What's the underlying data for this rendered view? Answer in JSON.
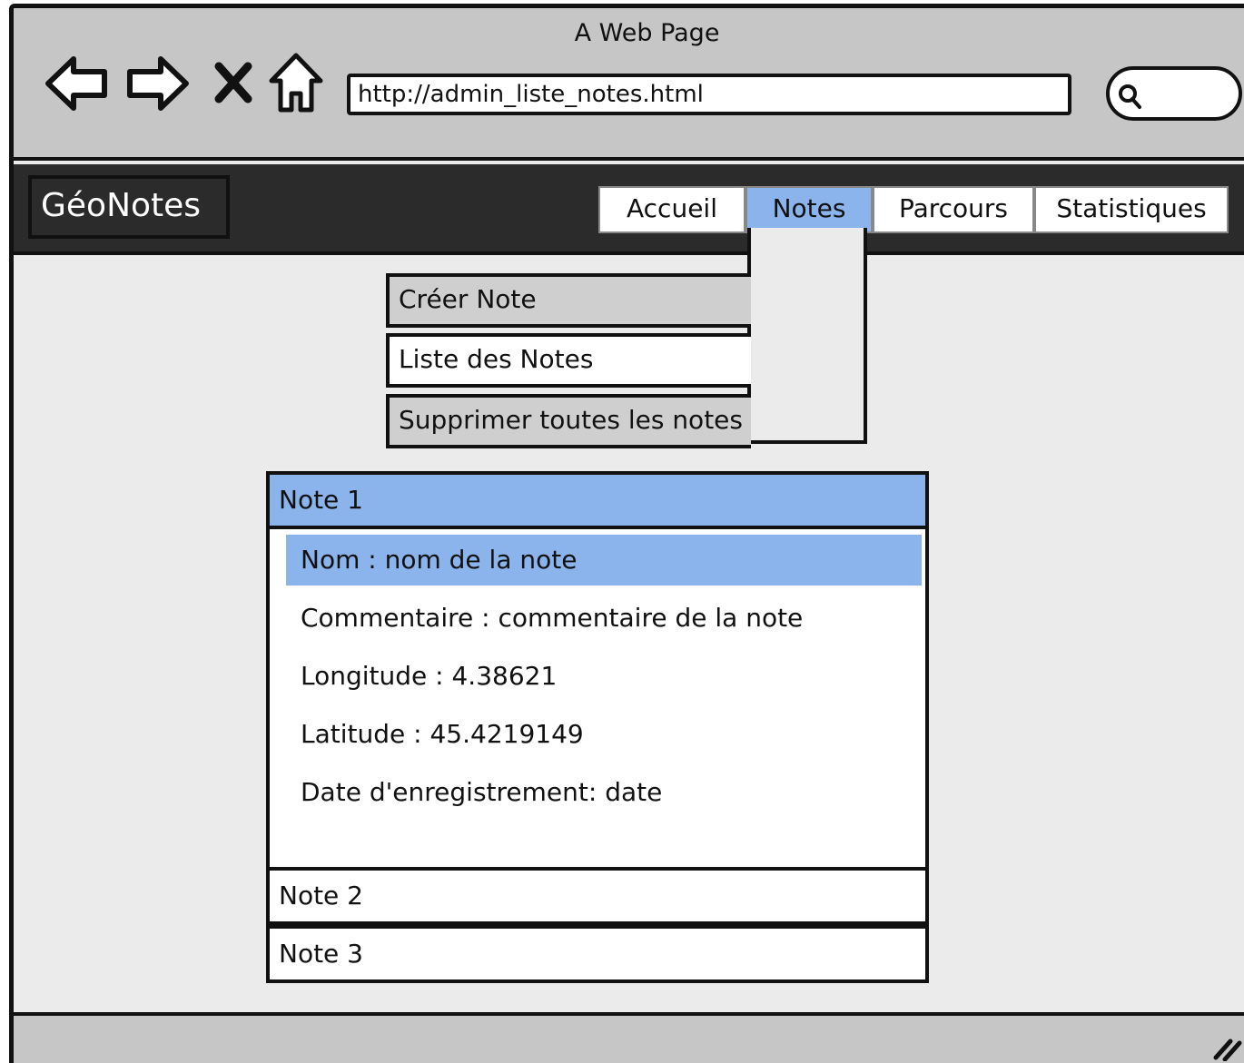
{
  "browser": {
    "window_title": "A Web Page",
    "url": "http://admin_liste_notes.html"
  },
  "app": {
    "brand": "GéoNotes",
    "nav_tabs": [
      "Accueil",
      "Notes",
      "Parcours",
      "Statistiques"
    ],
    "active_tab": "Notes"
  },
  "dropdown_menu": {
    "items": [
      "Créer Note",
      "Liste des Notes",
      "Supprimer toutes les notes"
    ],
    "highlighted": "Liste des Notes"
  },
  "notes": {
    "items": [
      {
        "title": "Note 1",
        "expanded": true,
        "fields": [
          "Nom : nom de la note",
          "Commentaire : commentaire de la note",
          "Longitude : 4.38621",
          "Latitude : 45.4219149",
          "Date d'enregistrement: date"
        ],
        "selected_field": "Nom : nom de la note"
      },
      {
        "title": "Note 2",
        "expanded": false
      },
      {
        "title": "Note 3",
        "expanded": false
      }
    ]
  },
  "colors": {
    "chrome": "#c6c6c6",
    "header": "#2b2b2b",
    "content": "#ebebeb",
    "highlight": "#8bb4ec",
    "menu_item": "#cfcfcf"
  },
  "icons": [
    "back-arrow-icon",
    "forward-arrow-icon",
    "stop-icon",
    "home-icon",
    "search-icon",
    "resize-grip-icon"
  ]
}
